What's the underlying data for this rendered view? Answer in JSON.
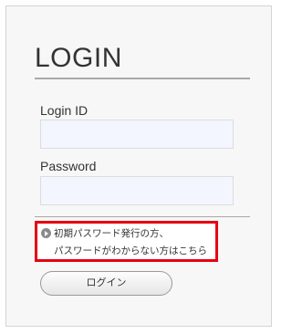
{
  "login": {
    "title": "LOGIN",
    "login_id_label": "Login ID",
    "login_id_value": "",
    "password_label": "Password",
    "password_value": "",
    "notice_line_1": "初期パスワード発行の方、",
    "notice_line_2": "パスワードがわからない方はこちら",
    "submit_label": "ログイン"
  },
  "colors": {
    "background": "#f7f7f7",
    "input_background": "#f3f6ff",
    "highlight_border": "#e60012",
    "text": "#333333"
  },
  "icons": {
    "notice_arrow": "circle-arrow-right-icon"
  }
}
